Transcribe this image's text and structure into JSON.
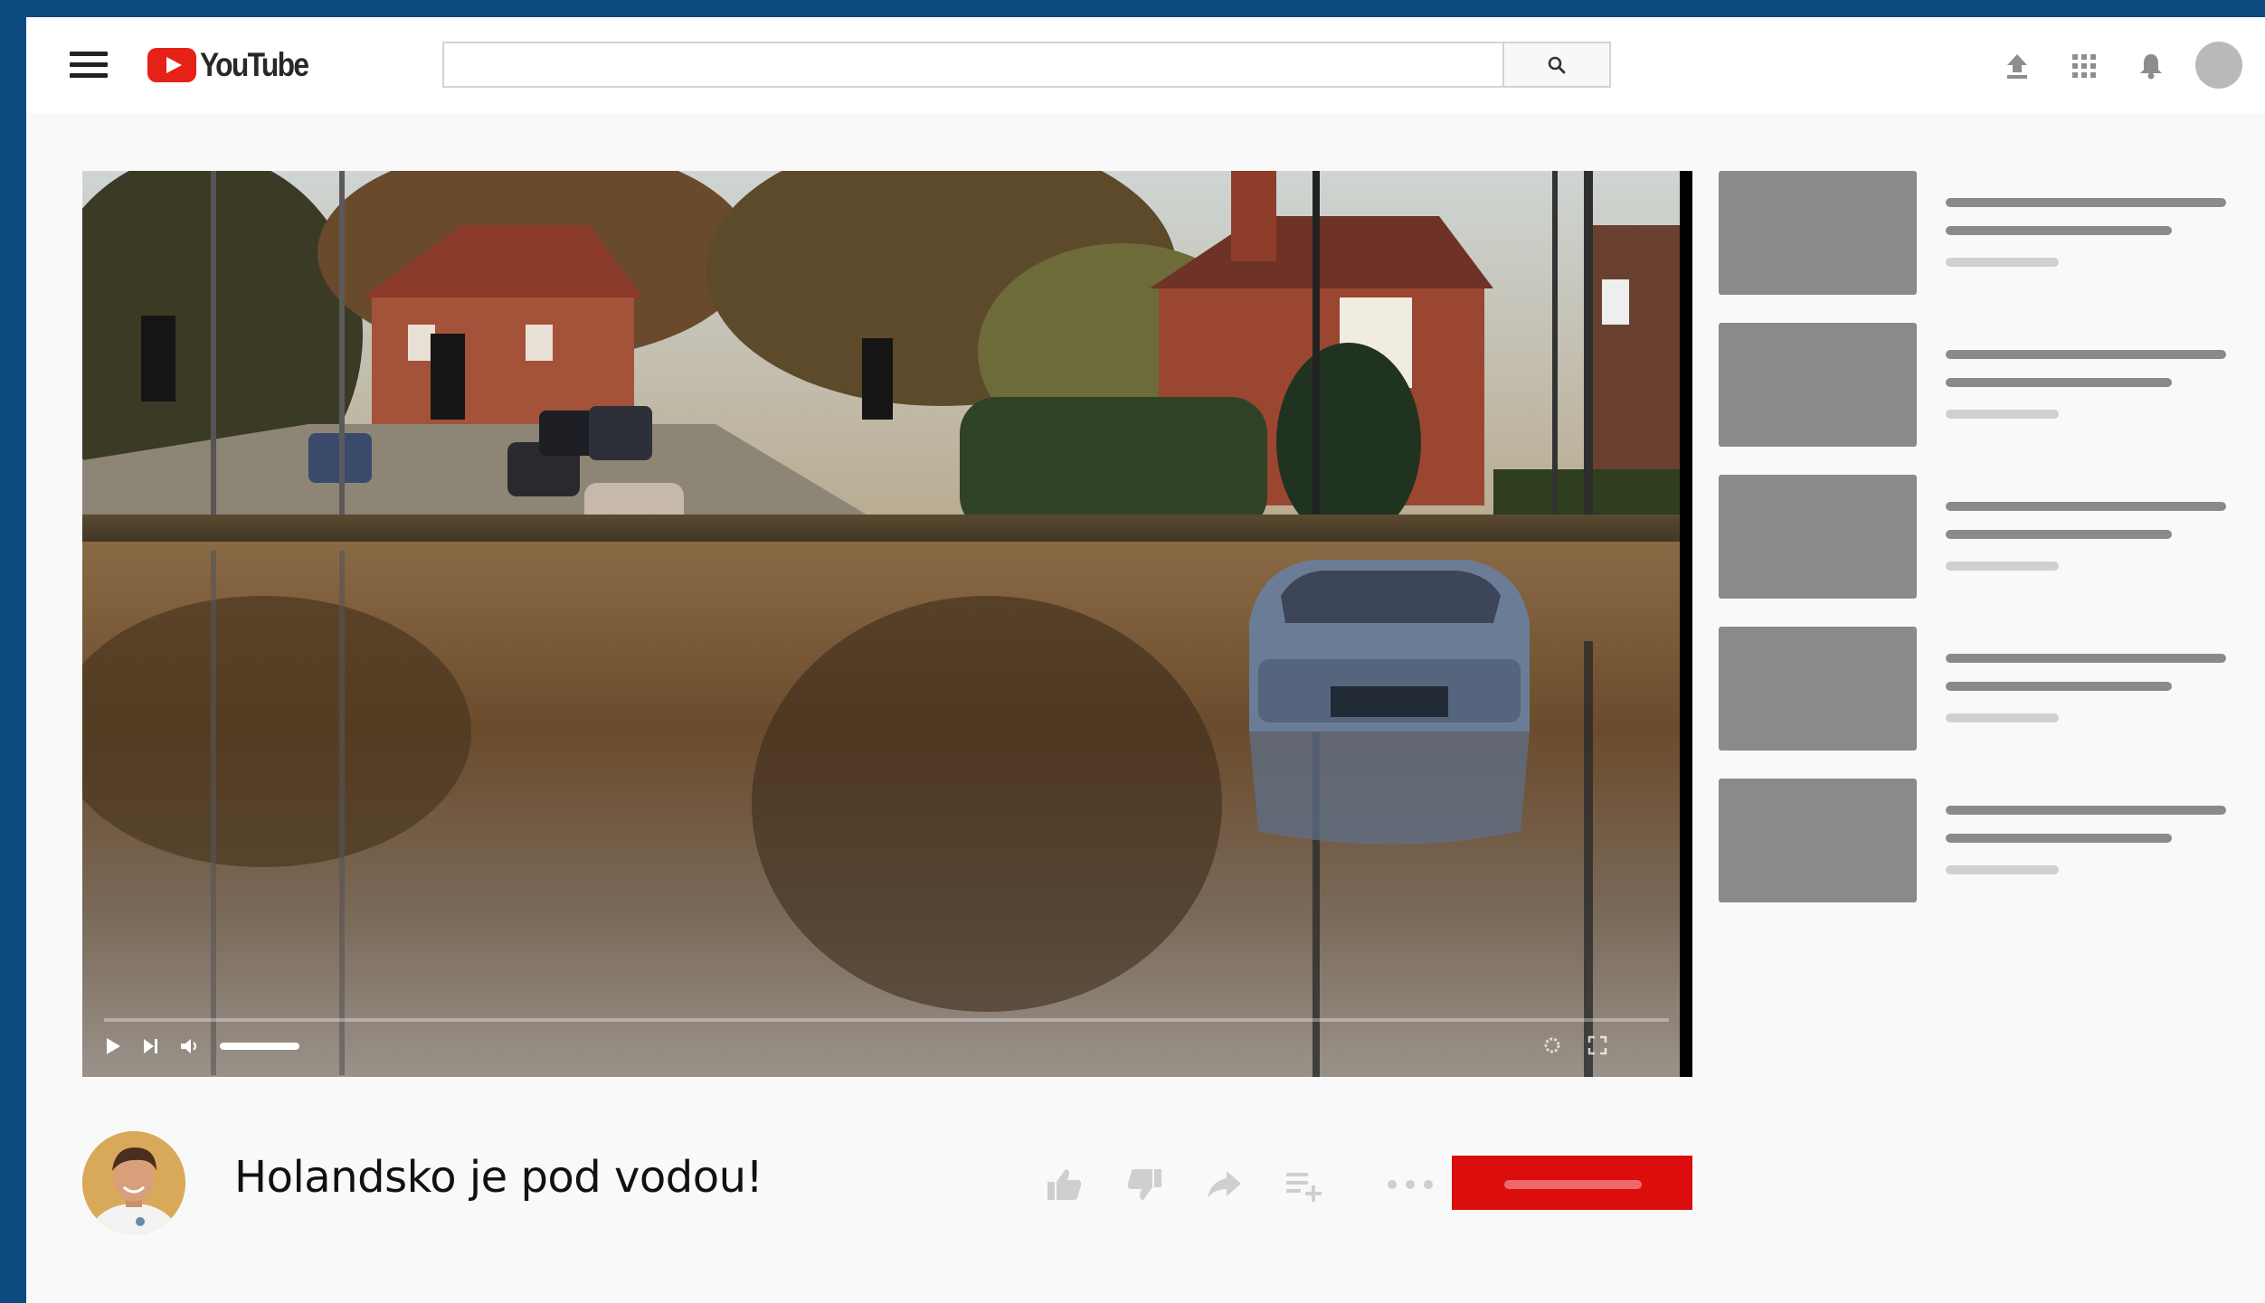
{
  "header": {
    "logo_text": "YouTube",
    "search_value": ""
  },
  "video": {
    "title": "Holandsko je pod vodou!",
    "progress_fraction": 0.0,
    "volume_fraction": 0.6
  },
  "recommendations": {
    "count_visible": 5
  },
  "colors": {
    "frame_border": "#0d4a80",
    "brand_red": "#e62117",
    "subscribe_red": "#dc0d0d",
    "placeholder_gray": "#8a8a8a",
    "placeholder_light": "#d0d0d0"
  },
  "icons": {
    "menu": "hamburger-icon",
    "search": "search-icon",
    "upload": "upload-icon",
    "apps": "apps-grid-icon",
    "notifications": "bell-icon",
    "like": "thumbs-up-icon",
    "dislike": "thumbs-down-icon",
    "share": "share-icon",
    "save": "add-to-playlist-icon",
    "more": "more-icon"
  }
}
